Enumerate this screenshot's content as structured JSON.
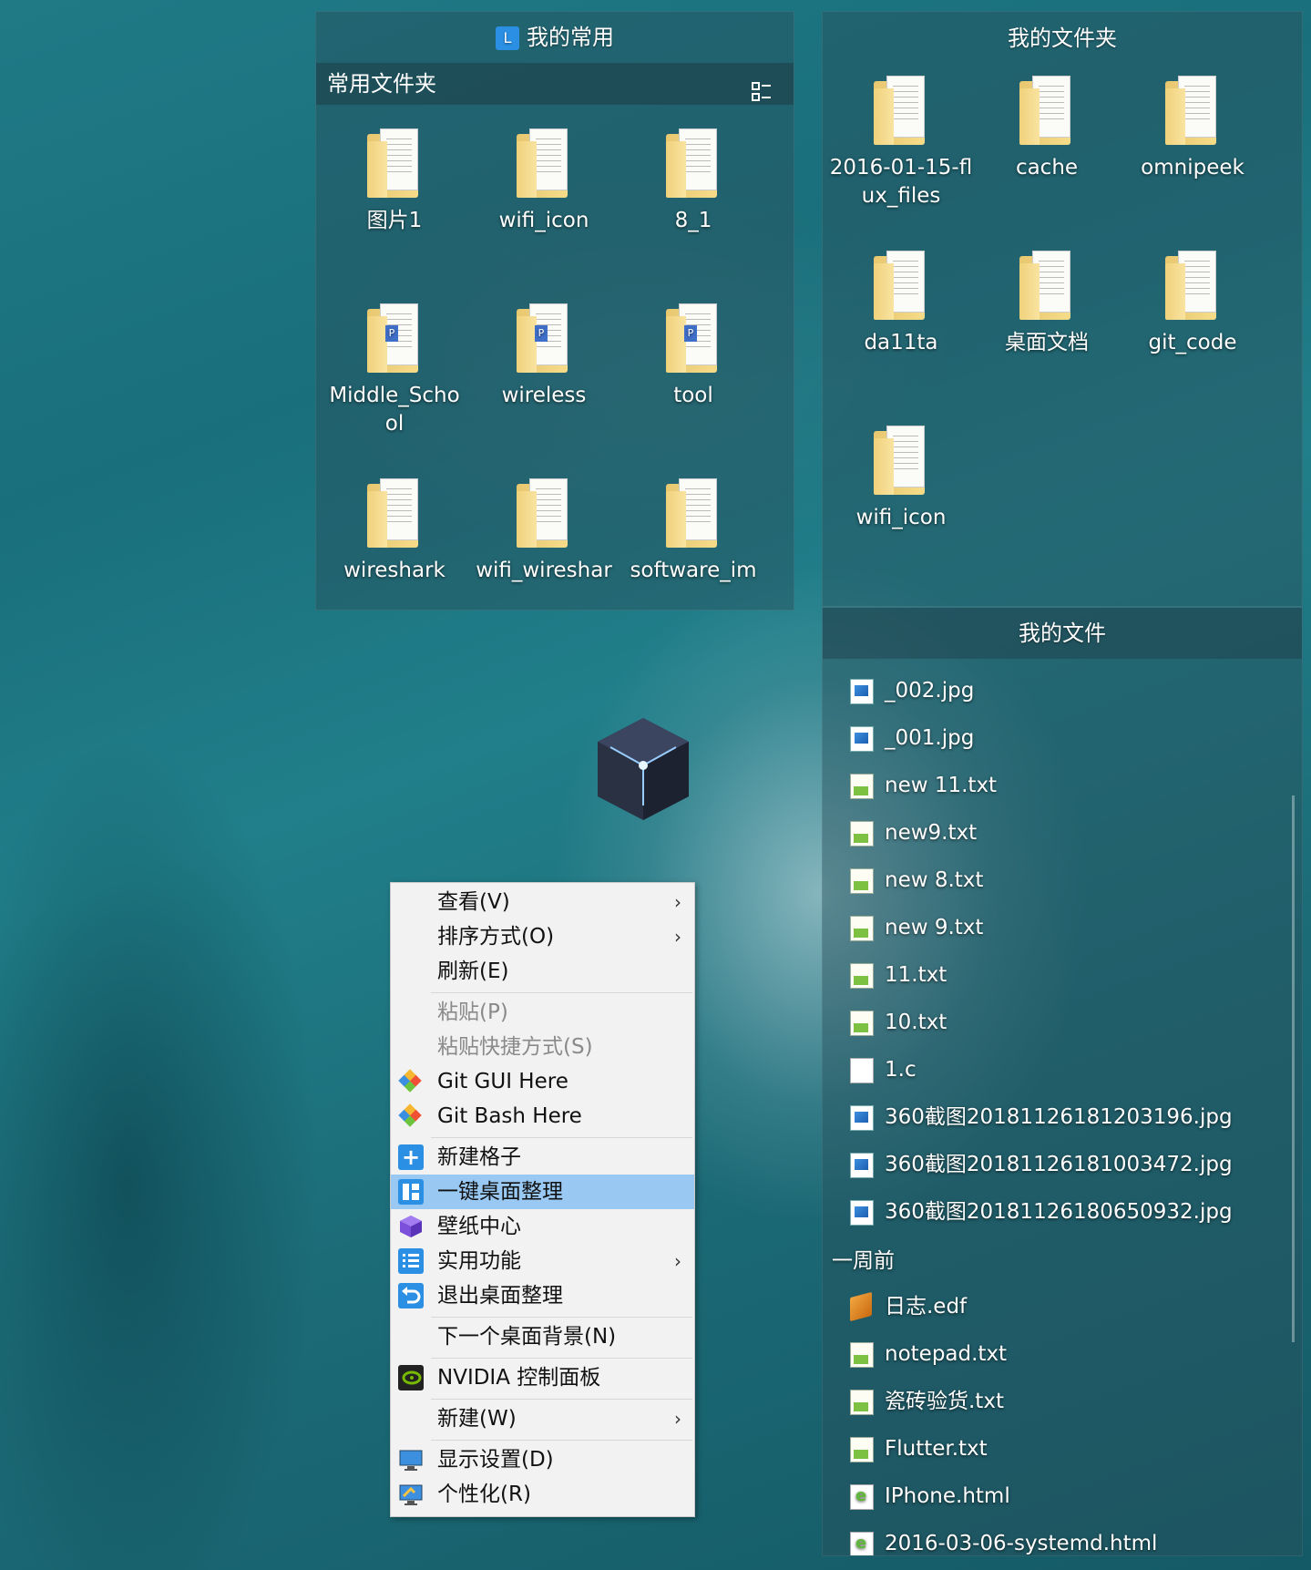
{
  "common": {
    "title": "我的常用",
    "subheader": "常用文件夹",
    "items": [
      "图片1",
      "wifi_icon",
      "8_1",
      "Middle_Scho ol",
      "wireless",
      "tool",
      "wireshark",
      "wifi_wireshar",
      "software_im"
    ]
  },
  "folders": {
    "title": "我的文件夹",
    "items": [
      "2016-01-15-flux_files",
      "cache",
      "omnipeek",
      "da11ta",
      "桌面文档",
      "git_code",
      "wifi_icon"
    ]
  },
  "files": {
    "title": "我的文件",
    "recent": [
      {
        "name": "_002.jpg",
        "type": "img"
      },
      {
        "name": "_001.jpg",
        "type": "img"
      },
      {
        "name": "new 11.txt",
        "type": "txt"
      },
      {
        "name": "new9.txt",
        "type": "txt"
      },
      {
        "name": "new 8.txt",
        "type": "txt"
      },
      {
        "name": "new 9.txt",
        "type": "txt"
      },
      {
        "name": "11.txt",
        "type": "txt"
      },
      {
        "name": "10.txt",
        "type": "txt"
      },
      {
        "name": "1.c",
        "type": "c"
      },
      {
        "name": "360截图20181126181203196.jpg",
        "type": "img"
      },
      {
        "name": "360截图20181126181003472.jpg",
        "type": "img"
      },
      {
        "name": "360截图20181126180650932.jpg",
        "type": "img"
      }
    ],
    "week_header": "一周前",
    "week": [
      {
        "name": "日志.edf",
        "type": "edf"
      },
      {
        "name": "notepad.txt",
        "type": "txt"
      },
      {
        "name": "瓷砖验货.txt",
        "type": "txt"
      },
      {
        "name": "Flutter.txt",
        "type": "txt"
      },
      {
        "name": "IPhone.html",
        "type": "html"
      },
      {
        "name": "2016-03-06-systemd.html",
        "type": "html"
      }
    ]
  },
  "menu": {
    "view": "查看(V)",
    "sort": "排序方式(O)",
    "refresh": "刷新(E)",
    "paste": "粘贴(P)",
    "paste_shortcut": "粘贴快捷方式(S)",
    "git_gui": "Git GUI Here",
    "git_bash": "Git Bash Here",
    "new_grid": "新建格子",
    "organize": "一键桌面整理",
    "wallpaper": "壁纸中心",
    "utilities": "实用功能",
    "exit_organize": "退出桌面整理",
    "next_bg": "下一个桌面背景(N)",
    "nvidia": "NVIDIA 控制面板",
    "new": "新建(W)",
    "display": "显示设置(D)",
    "personalize": "个性化(R)",
    "submenu_arrow": "›"
  },
  "icons": {
    "logo": "L",
    "layout_toggle": "layout-toggle-icon",
    "plus": "+"
  }
}
